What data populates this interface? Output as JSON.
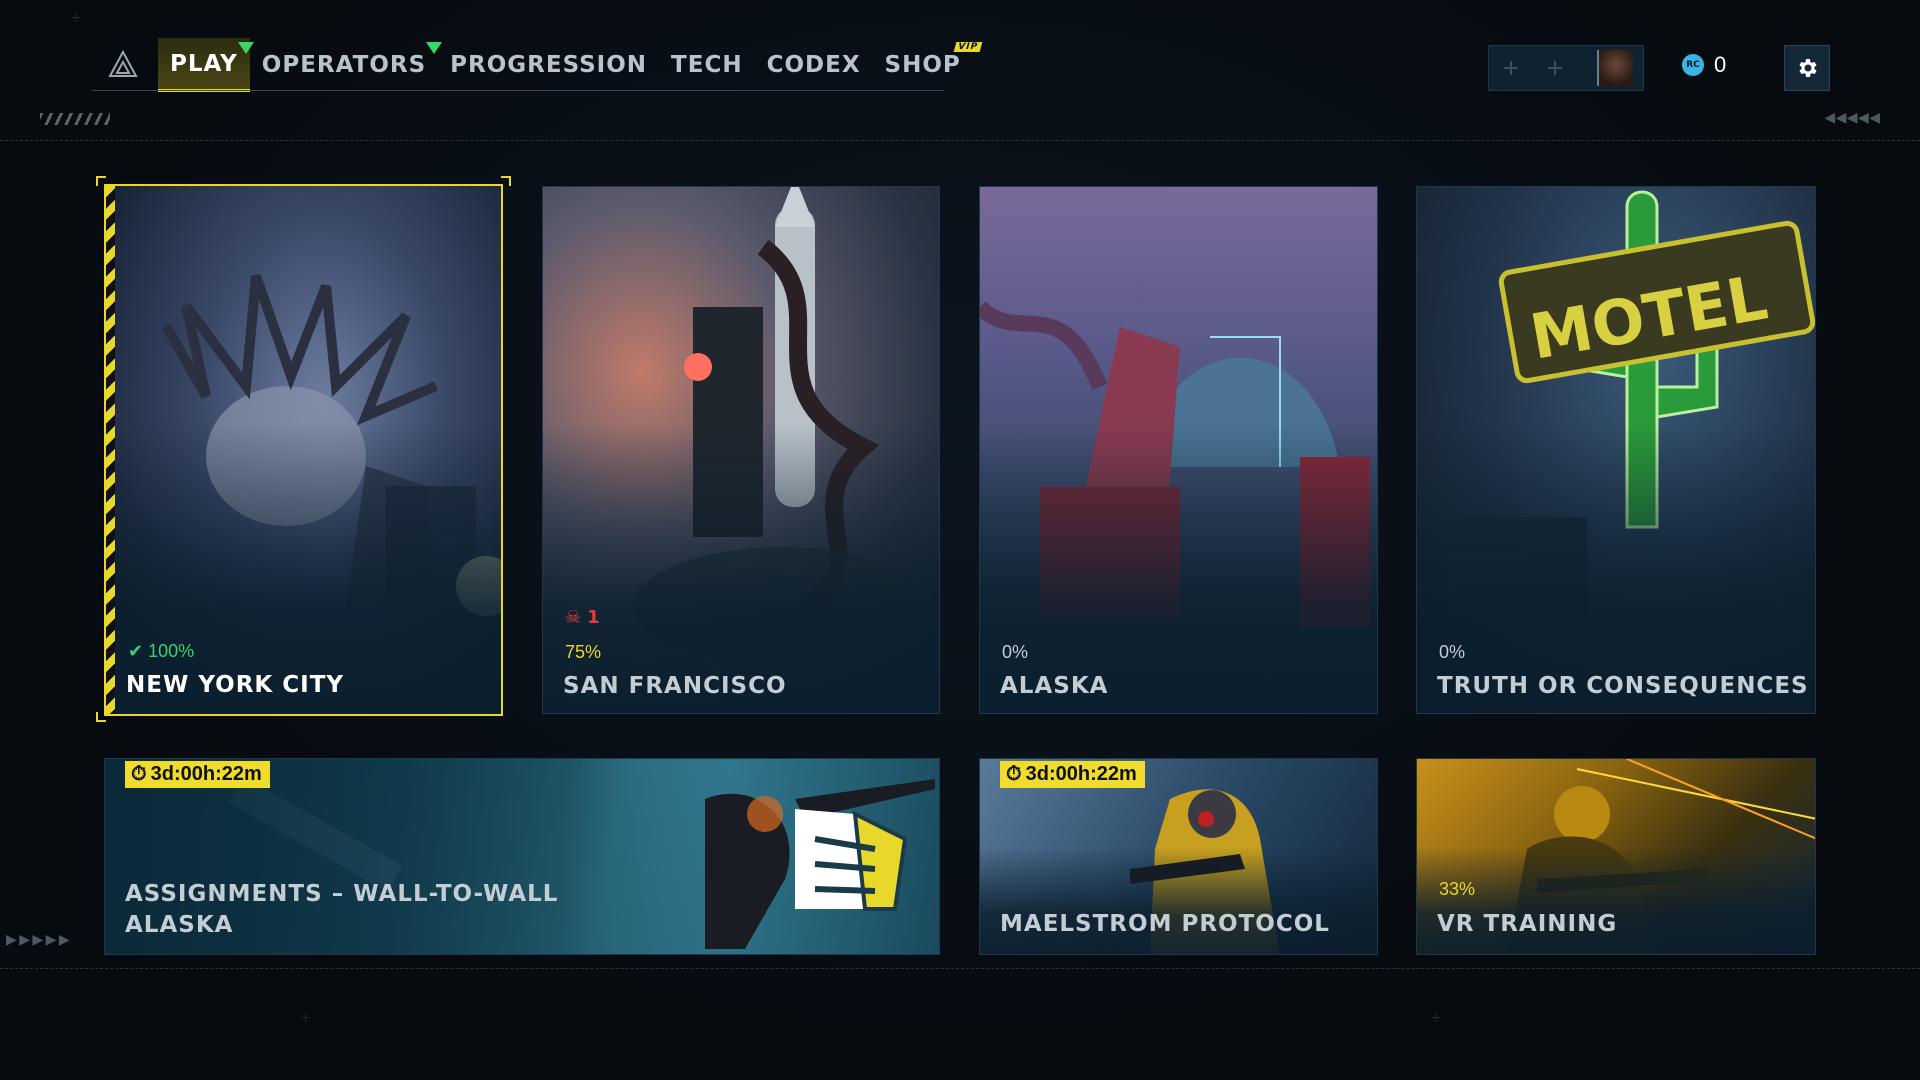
{
  "nav": {
    "items": [
      {
        "label": "PLAY",
        "active": true,
        "indicator": true
      },
      {
        "label": "OPERATORS",
        "active": false,
        "indicator": true
      },
      {
        "label": "PROGRESSION",
        "active": false
      },
      {
        "label": "TECH",
        "active": false
      },
      {
        "label": "CODEX",
        "active": false
      },
      {
        "label": "SHOP",
        "active": false,
        "badge": "VIP"
      }
    ]
  },
  "header": {
    "currency_icon": "RC",
    "currency_value": "0",
    "settings_icon": "gear-icon",
    "party_slot_icon": "+"
  },
  "maps": [
    {
      "name": "NEW YORK CITY",
      "progress": "100%",
      "complete": true,
      "selected": true
    },
    {
      "name": "SAN FRANCISCO",
      "progress": "75%",
      "squad_count": "1"
    },
    {
      "name": "ALASKA",
      "progress": "0%"
    },
    {
      "name": "TRUTH OR CONSEQUENCES",
      "progress": "0%"
    }
  ],
  "modes": [
    {
      "name": "ASSIGNMENTS – WALL-TO-WALL ALASKA",
      "timer": "3d:00h:22m"
    },
    {
      "name": "MAELSTROM PROTOCOL",
      "timer": "3d:00h:22m"
    },
    {
      "name": "VR TRAINING",
      "progress": "33%"
    }
  ],
  "colors": {
    "accent": "#e8d82c",
    "complete": "#36d46a",
    "danger": "#e03c3c"
  }
}
